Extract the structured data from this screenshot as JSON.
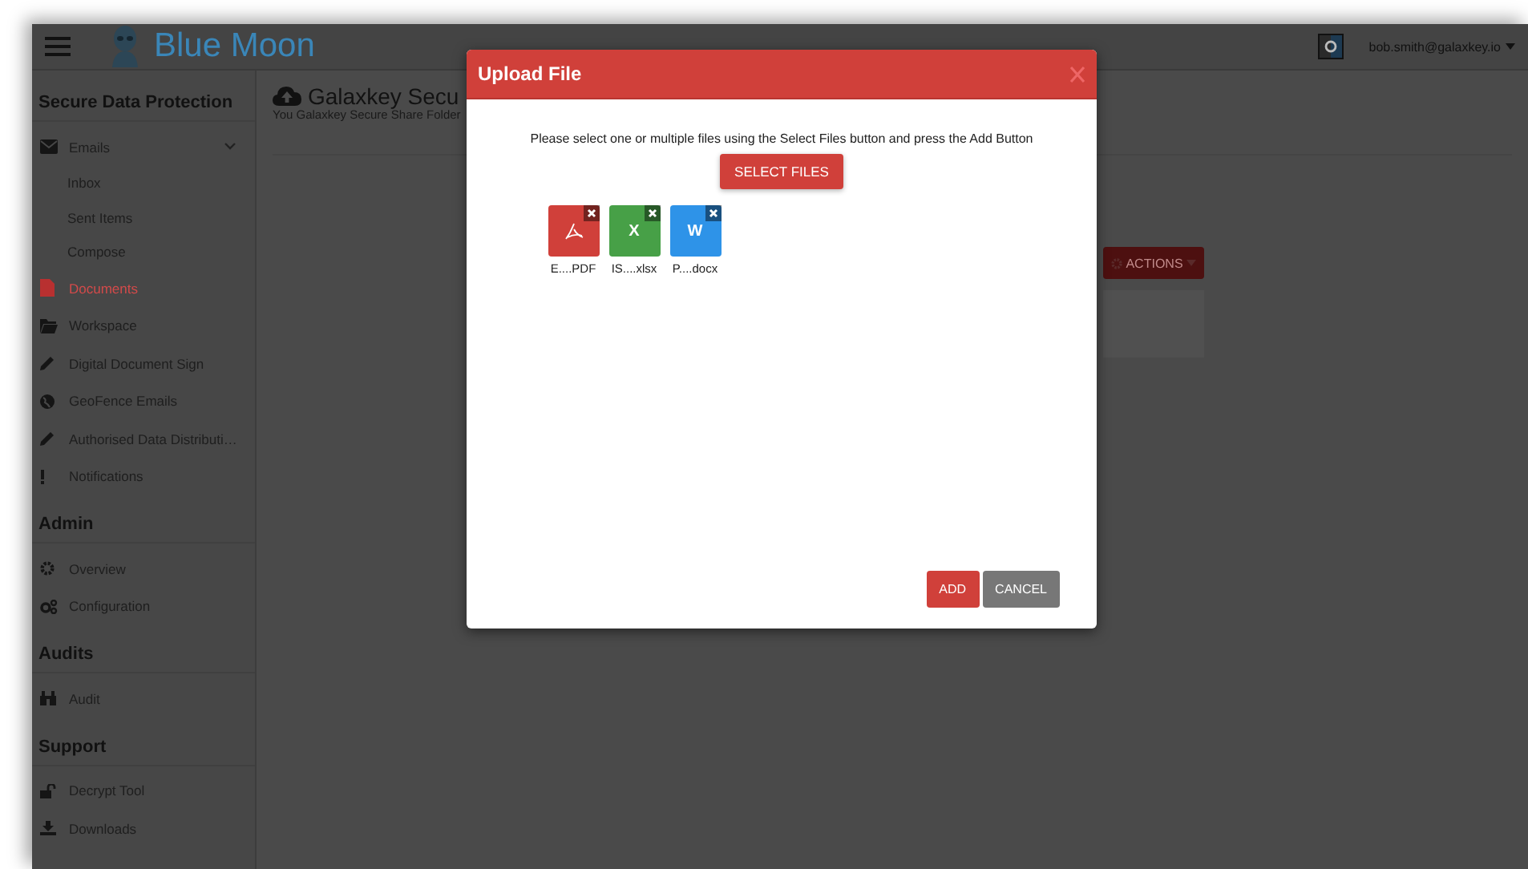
{
  "header": {
    "brand": "Blue Moon",
    "user": "bob.smith@galaxkey.io"
  },
  "sidebar": {
    "sections": [
      {
        "title": "Secure Data Protection",
        "items": [
          {
            "label": "Emails",
            "selected": false,
            "expanded": true,
            "children": [
              {
                "label": "Inbox",
                "selected": false
              },
              {
                "label": "Sent Items",
                "selected": false
              },
              {
                "label": "Compose",
                "selected": false
              }
            ]
          },
          {
            "label": "Documents",
            "selected": true
          },
          {
            "label": "Workspace",
            "selected": false
          },
          {
            "label": "Digital Document Sign",
            "selected": false
          },
          {
            "label": "GeoFence Emails",
            "selected": false
          },
          {
            "label": "Authorised Data Distributi…",
            "selected": false
          },
          {
            "label": "Notifications",
            "selected": false
          }
        ]
      },
      {
        "title": "Admin",
        "items": [
          {
            "label": "Overview",
            "selected": false
          },
          {
            "label": "Configuration",
            "selected": false
          }
        ]
      },
      {
        "title": "Audits",
        "items": [
          {
            "label": "Audit",
            "selected": false
          }
        ]
      },
      {
        "title": "Support",
        "items": [
          {
            "label": "Decrypt Tool",
            "selected": false
          },
          {
            "label": "Downloads",
            "selected": false
          }
        ]
      }
    ]
  },
  "page": {
    "title": "Galaxkey Secu",
    "subtitle": "You Galaxkey Secure Share Folder",
    "actions_button": "ACTIONS"
  },
  "dialog": {
    "title": "Upload File",
    "instruction": "Please select one or multiple files using the Select Files button and press the Add Button",
    "select_button": "SELECT FILES",
    "files": [
      {
        "kind": "pdf",
        "name": "E....PDF"
      },
      {
        "kind": "xlsx",
        "glyph": "X",
        "name": "IS....xlsx"
      },
      {
        "kind": "docx",
        "glyph": "W",
        "name": "P....docx"
      }
    ],
    "buttons": [
      {
        "kind": "primary",
        "label": "ADD"
      },
      {
        "kind": "secondary",
        "label": "CANCEL"
      }
    ]
  }
}
